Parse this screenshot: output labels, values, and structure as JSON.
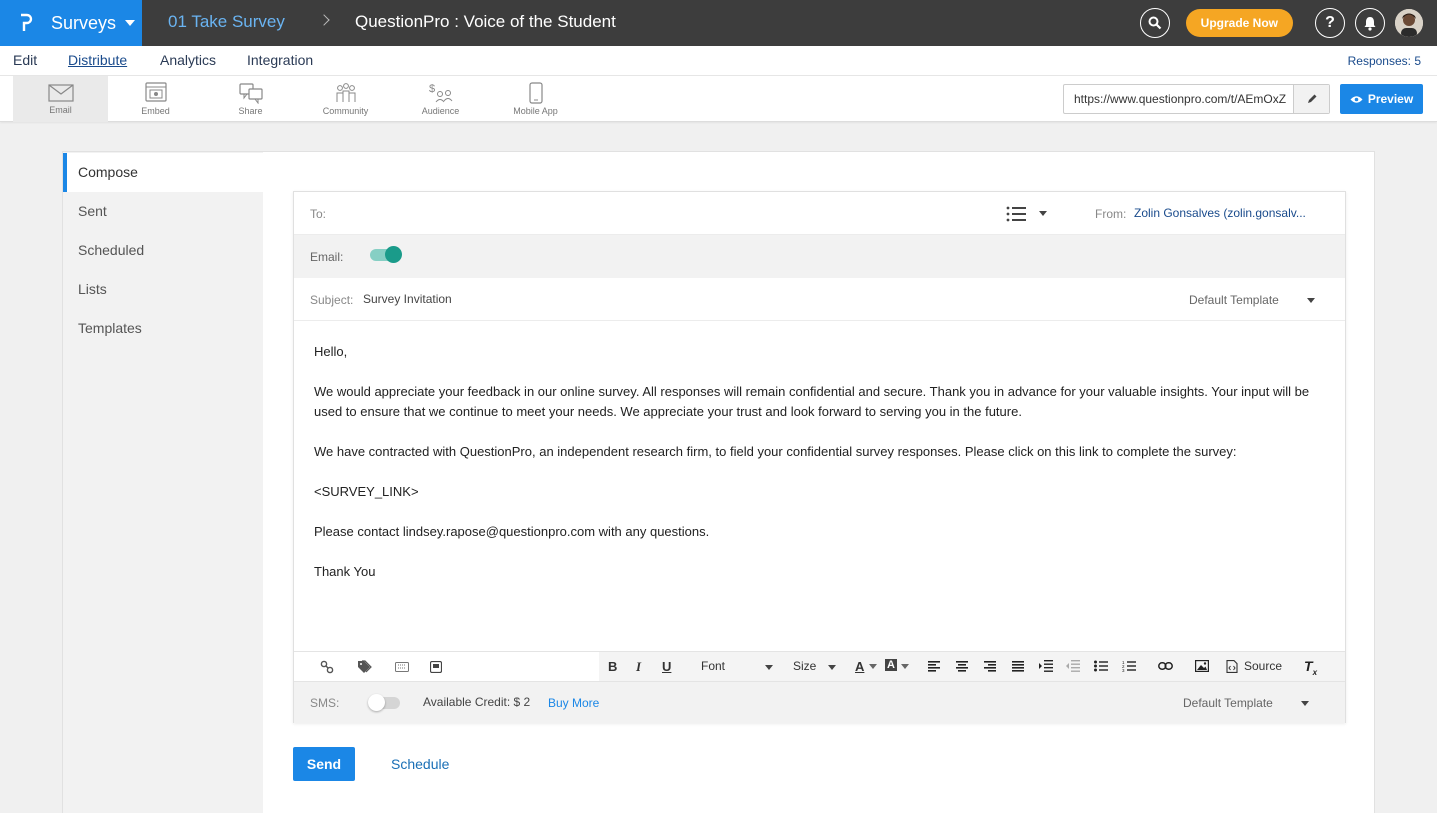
{
  "topbar": {
    "brand": "Surveys",
    "survey_name": "01 Take Survey",
    "page_title": "QuestionPro : Voice of the Student",
    "upgrade_label": "Upgrade Now",
    "help_label": "?",
    "colors": {
      "brand": "#1b87e6",
      "bar": "#3d3d3d",
      "upgrade": "#f5a623",
      "survey_link": "#6ab4f2"
    }
  },
  "tabs": {
    "items": [
      "Edit",
      "Distribute",
      "Analytics",
      "Integration"
    ],
    "active": "Distribute",
    "responses": "Responses: 5"
  },
  "subbar": {
    "tools": [
      {
        "label": "Email",
        "icon": "envelope-icon"
      },
      {
        "label": "Embed",
        "icon": "embed-icon"
      },
      {
        "label": "Share",
        "icon": "share-icon"
      },
      {
        "label": "Community",
        "icon": "community-icon"
      },
      {
        "label": "Audience",
        "icon": "audience-icon"
      },
      {
        "label": "Mobile App",
        "icon": "mobile-icon"
      }
    ],
    "url": "https://www.questionpro.com/t/AEmOxZ",
    "preview_label": "Preview"
  },
  "leftnav": {
    "items": [
      "Compose",
      "Sent",
      "Scheduled",
      "Lists",
      "Templates"
    ],
    "active": "Compose"
  },
  "compose": {
    "to_label": "To:",
    "from_label": "From:",
    "from_value": "Zolin Gonsalves (zolin.gonsalv...",
    "email_label": "Email:",
    "email_enabled": true,
    "subject_label": "Subject:",
    "subject_value": "Survey Invitation",
    "template_value": "Default Template",
    "body": [
      "Hello,",
      "We would appreciate your feedback in our online survey. All responses will remain confidential and secure. Thank you in advance for your valuable insights. Your input will be used to ensure that we continue to meet your needs. We appreciate your trust and look forward to serving you in the future.",
      "We have contracted with QuestionPro, an independent research firm, to field your confidential survey responses. Please click on this link to complete the survey:",
      "<SURVEY_LINK>",
      "Please contact lindsey.rapose@questionpro.com with any questions.",
      "Thank You"
    ],
    "editor": {
      "bold": "B",
      "italic": "I",
      "underline": "U",
      "font_label": "Font",
      "size_label": "Size",
      "text_color": "A",
      "bg_color": "A",
      "source_label": "Source",
      "clear_label": "T"
    },
    "sms_label": "SMS:",
    "sms_enabled": false,
    "credit_label": "Available Credit: $ 2",
    "buy_more": "Buy More",
    "sms_template_value": "Default Template"
  },
  "actions": {
    "send_label": "Send",
    "schedule_label": "Schedule"
  }
}
